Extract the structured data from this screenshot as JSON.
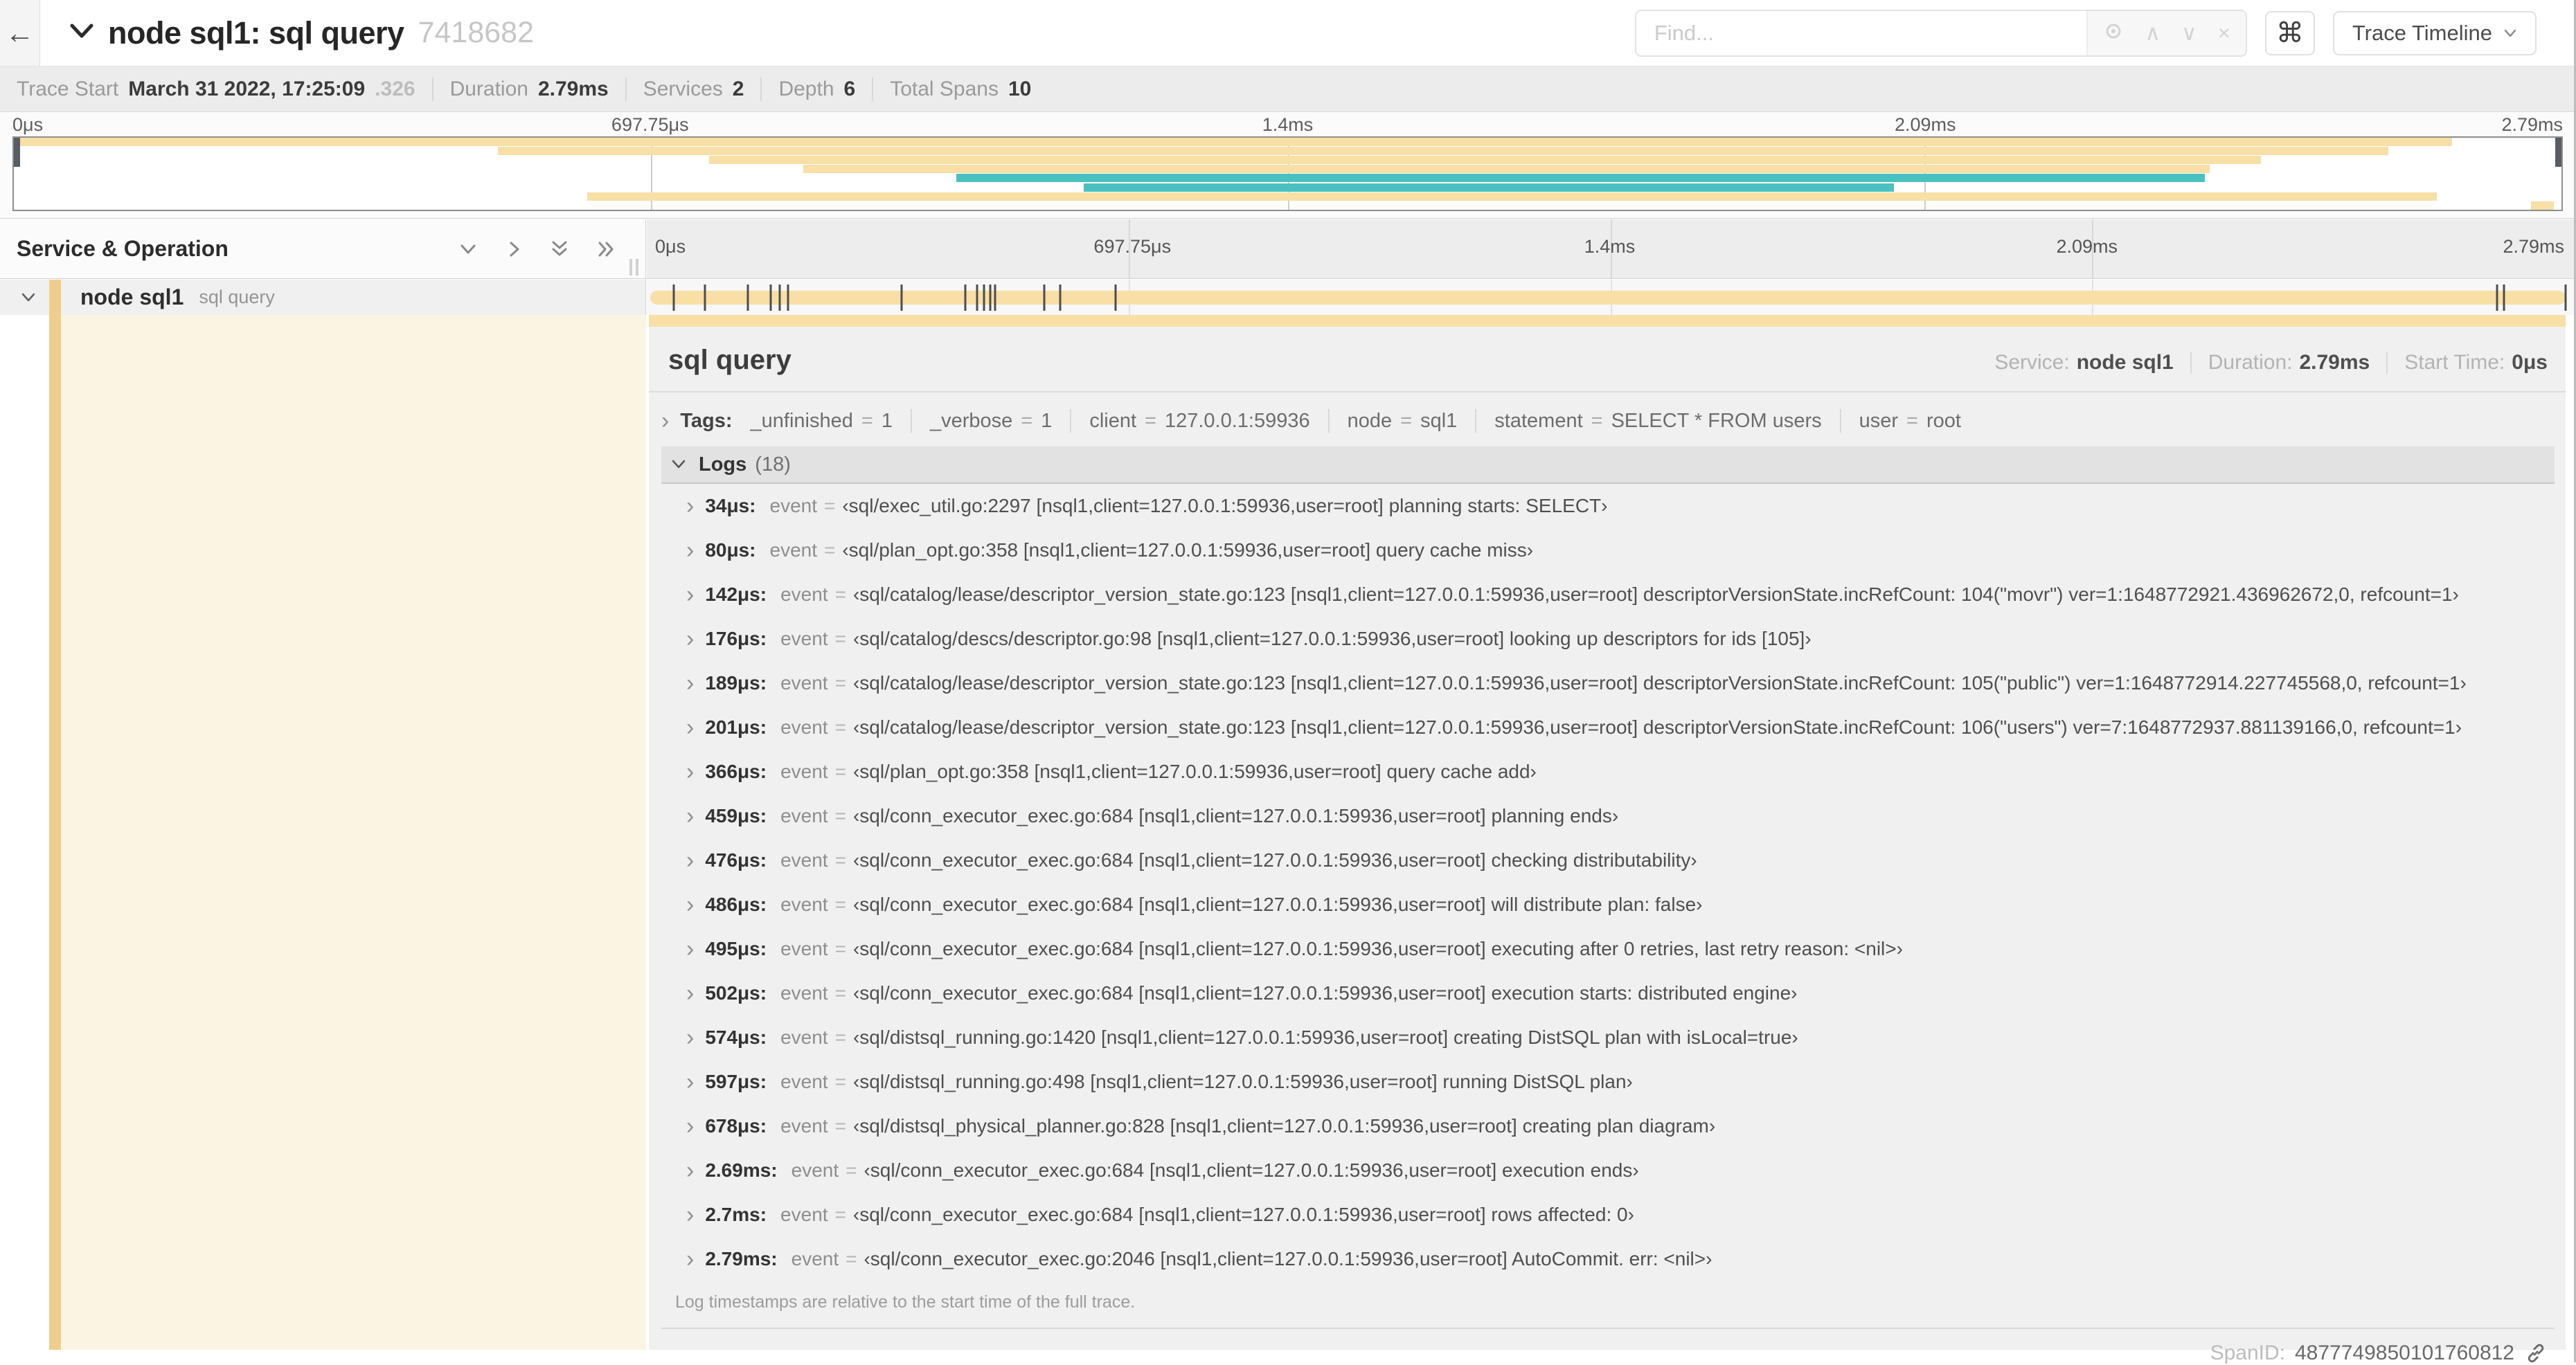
{
  "colors": {
    "span_tan": "#f7dfa6",
    "span_teal": "#4ac1c1",
    "service_stripe": "#efce8d",
    "detail_left_bg": "#fcf4e3"
  },
  "icons": {
    "back": "←",
    "shortcut": "⌘",
    "find_prev": "∧",
    "find_next": "∨",
    "find_clear": "×",
    "expander": "›"
  },
  "header": {
    "title": "node sql1: sql query",
    "trace_id": "7418682",
    "find_placeholder": "Find...",
    "view_dropdown_label": "Trace Timeline"
  },
  "summary": {
    "items": [
      {
        "label": "Trace Start",
        "value": "March 31 2022, 17:25:09",
        "suffix": ".326"
      },
      {
        "label": "Duration",
        "value": "2.79ms"
      },
      {
        "label": "Services",
        "value": "2"
      },
      {
        "label": "Depth",
        "value": "6"
      },
      {
        "label": "Total Spans",
        "value": "10"
      }
    ]
  },
  "minimap": {
    "rows": [
      {
        "row": 1,
        "start": 0,
        "end": 95.7,
        "color": "tan"
      },
      {
        "row": 2,
        "start": 19.0,
        "end": 93.2,
        "color": "tan"
      },
      {
        "row": 3,
        "start": 27.3,
        "end": 88.2,
        "color": "tan"
      },
      {
        "row": 4,
        "start": 31.0,
        "end": 86.2,
        "color": "tan"
      },
      {
        "row": 5,
        "start": 37.0,
        "end": 86.0,
        "color": "teal"
      },
      {
        "row": 6,
        "start": 42.0,
        "end": 73.8,
        "color": "teal"
      },
      {
        "row": 7,
        "start": 22.5,
        "end": 95.1,
        "color": "tan"
      },
      {
        "row": 8,
        "start": 98.8,
        "end": 99.7,
        "color": "tan"
      }
    ]
  },
  "timeline": {
    "column_header": "Service & Operation",
    "ticks": [
      {
        "label": "0μs",
        "pos": 0
      },
      {
        "label": "697.75μs",
        "pos": 25
      },
      {
        "label": "1.4ms",
        "pos": 50
      },
      {
        "label": "2.09ms",
        "pos": 75
      },
      {
        "label": "2.79ms",
        "pos": 100
      }
    ],
    "span": {
      "service": "node sql1",
      "operation": "sql query",
      "total_us": 2790,
      "log_markers_us": [
        34,
        80,
        142,
        176,
        189,
        201,
        366,
        459,
        476,
        486,
        495,
        502,
        574,
        597,
        678,
        2690,
        2700,
        2790
      ]
    }
  },
  "detail": {
    "title": "sql query",
    "service_label": "Service:",
    "service": "node sql1",
    "duration_label": "Duration:",
    "duration": "2.79ms",
    "start_label": "Start Time:",
    "start": "0μs",
    "tags_label": "Tags:",
    "tags": [
      {
        "key": "_unfinished",
        "value": "1"
      },
      {
        "key": "_verbose",
        "value": "1"
      },
      {
        "key": "client",
        "value": "127.0.0.1:59936"
      },
      {
        "key": "node",
        "value": "sql1"
      },
      {
        "key": "statement",
        "value": "SELECT * FROM users"
      },
      {
        "key": "user",
        "value": "root"
      }
    ],
    "logs_label": "Logs",
    "logs_count": "(18)",
    "logs": [
      {
        "t": "34μs:",
        "k": "event",
        "v": "‹sql/exec_util.go:2297 [nsql1,client=127.0.0.1:59936,user=root] planning starts: SELECT›"
      },
      {
        "t": "80μs:",
        "k": "event",
        "v": "‹sql/plan_opt.go:358 [nsql1,client=127.0.0.1:59936,user=root] query cache miss›"
      },
      {
        "t": "142μs:",
        "k": "event",
        "v": "‹sql/catalog/lease/descriptor_version_state.go:123 [nsql1,client=127.0.0.1:59936,user=root] descriptorVersionState.incRefCount: 104(\"movr\") ver=1:1648772921.436962672,0, refcount=1›"
      },
      {
        "t": "176μs:",
        "k": "event",
        "v": "‹sql/catalog/descs/descriptor.go:98 [nsql1,client=127.0.0.1:59936,user=root] looking up descriptors for ids [105]›"
      },
      {
        "t": "189μs:",
        "k": "event",
        "v": "‹sql/catalog/lease/descriptor_version_state.go:123 [nsql1,client=127.0.0.1:59936,user=root] descriptorVersionState.incRefCount: 105(\"public\") ver=1:1648772914.227745568,0, refcount=1›"
      },
      {
        "t": "201μs:",
        "k": "event",
        "v": "‹sql/catalog/lease/descriptor_version_state.go:123 [nsql1,client=127.0.0.1:59936,user=root] descriptorVersionState.incRefCount: 106(\"users\") ver=7:1648772937.881139166,0, refcount=1›"
      },
      {
        "t": "366μs:",
        "k": "event",
        "v": "‹sql/plan_opt.go:358 [nsql1,client=127.0.0.1:59936,user=root] query cache add›"
      },
      {
        "t": "459μs:",
        "k": "event",
        "v": "‹sql/conn_executor_exec.go:684 [nsql1,client=127.0.0.1:59936,user=root] planning ends›"
      },
      {
        "t": "476μs:",
        "k": "event",
        "v": "‹sql/conn_executor_exec.go:684 [nsql1,client=127.0.0.1:59936,user=root] checking distributability›"
      },
      {
        "t": "486μs:",
        "k": "event",
        "v": "‹sql/conn_executor_exec.go:684 [nsql1,client=127.0.0.1:59936,user=root] will distribute plan: false›"
      },
      {
        "t": "495μs:",
        "k": "event",
        "v": "‹sql/conn_executor_exec.go:684 [nsql1,client=127.0.0.1:59936,user=root] executing after 0 retries, last retry reason: <nil>›"
      },
      {
        "t": "502μs:",
        "k": "event",
        "v": "‹sql/conn_executor_exec.go:684 [nsql1,client=127.0.0.1:59936,user=root] execution starts: distributed engine›"
      },
      {
        "t": "574μs:",
        "k": "event",
        "v": "‹sql/distsql_running.go:1420 [nsql1,client=127.0.0.1:59936,user=root] creating DistSQL plan with isLocal=true›"
      },
      {
        "t": "597μs:",
        "k": "event",
        "v": "‹sql/distsql_running.go:498 [nsql1,client=127.0.0.1:59936,user=root] running DistSQL plan›"
      },
      {
        "t": "678μs:",
        "k": "event",
        "v": "‹sql/distsql_physical_planner.go:828 [nsql1,client=127.0.0.1:59936,user=root] creating plan diagram›"
      },
      {
        "t": "2.69ms:",
        "k": "event",
        "v": "‹sql/conn_executor_exec.go:684 [nsql1,client=127.0.0.1:59936,user=root] execution ends›"
      },
      {
        "t": "2.7ms:",
        "k": "event",
        "v": "‹sql/conn_executor_exec.go:684 [nsql1,client=127.0.0.1:59936,user=root] rows affected: 0›"
      },
      {
        "t": "2.79ms:",
        "k": "event",
        "v": "‹sql/conn_executor_exec.go:2046 [nsql1,client=127.0.0.1:59936,user=root] AutoCommit. err: <nil>›"
      }
    ],
    "footer": "Log timestamps are relative to the start time of the full trace.",
    "span_id_label": "SpanID:",
    "span_id": "4877749850101760812"
  }
}
